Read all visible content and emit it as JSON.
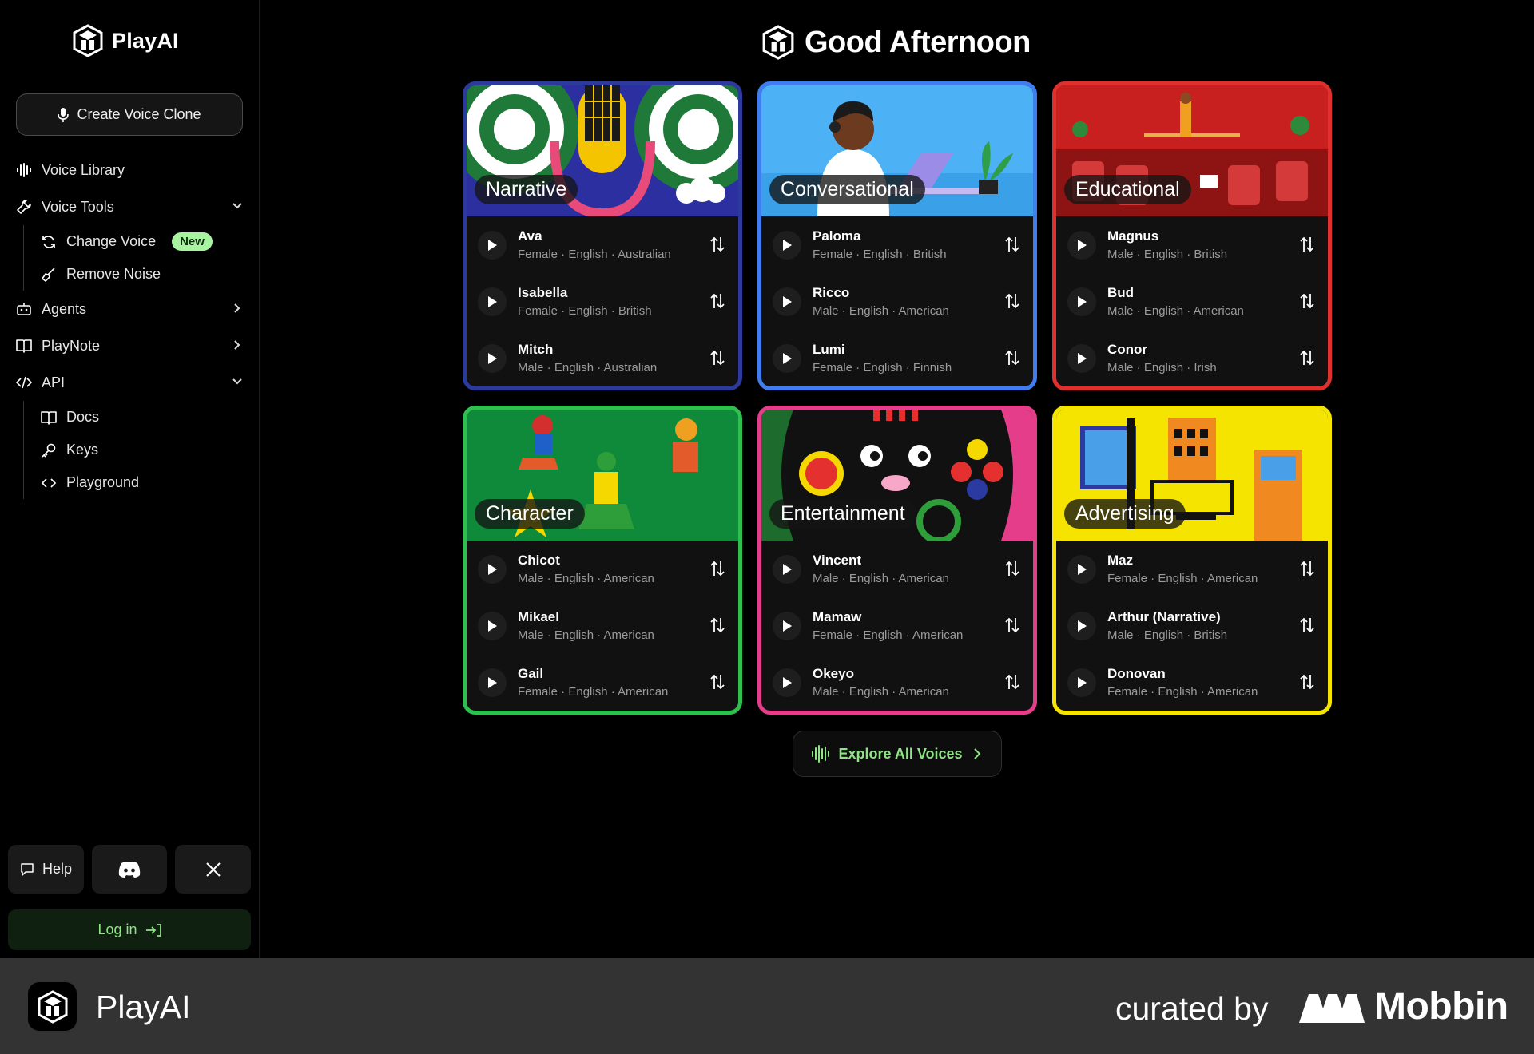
{
  "app": {
    "name": "PlayAI"
  },
  "sidebar": {
    "create_clone": "Create Voice Clone",
    "voice_library": "Voice Library",
    "voice_tools": "Voice Tools",
    "change_voice": "Change Voice",
    "new_badge": "New",
    "remove_noise": "Remove Noise",
    "agents": "Agents",
    "playnote": "PlayNote",
    "api": "API",
    "docs": "Docs",
    "keys": "Keys",
    "playground": "Playground",
    "help": "Help",
    "login": "Log in"
  },
  "main": {
    "greeting": "Good Afternoon",
    "explore": "Explore All Voices",
    "cards": [
      {
        "label": "Narrative",
        "border": "#2b3a9c",
        "voices": [
          {
            "name": "Ava",
            "meta": "Female · English · Australian"
          },
          {
            "name": "Isabella",
            "meta": "Female · English · British"
          },
          {
            "name": "Mitch",
            "meta": "Male · English · Australian"
          }
        ]
      },
      {
        "label": "Conversational",
        "border": "#3f7df0",
        "voices": [
          {
            "name": "Paloma",
            "meta": "Female · English · British"
          },
          {
            "name": "Ricco",
            "meta": "Male · English · American"
          },
          {
            "name": "Lumi",
            "meta": "Female · English · Finnish"
          }
        ]
      },
      {
        "label": "Educational",
        "border": "#e0302e",
        "voices": [
          {
            "name": "Magnus",
            "meta": "Male · English · British"
          },
          {
            "name": "Bud",
            "meta": "Male · English · American"
          },
          {
            "name": "Conor",
            "meta": "Male · English · Irish"
          }
        ]
      },
      {
        "label": "Character",
        "border": "#2fbf4f",
        "voices": [
          {
            "name": "Chicot",
            "meta": "Male · English · American"
          },
          {
            "name": "Mikael",
            "meta": "Male · English · American"
          },
          {
            "name": "Gail",
            "meta": "Female · English · American"
          }
        ]
      },
      {
        "label": "Entertainment",
        "border": "#e53d8a",
        "voices": [
          {
            "name": "Vincent",
            "meta": "Male · English · American"
          },
          {
            "name": "Mamaw",
            "meta": "Female · English · American"
          },
          {
            "name": "Okeyo",
            "meta": "Male · English · American"
          }
        ]
      },
      {
        "label": "Advertising",
        "border": "#f5e400",
        "voices": [
          {
            "name": "Maz",
            "meta": "Female · English · American"
          },
          {
            "name": "Arthur (Narrative)",
            "meta": "Male · English · British"
          },
          {
            "name": "Donovan",
            "meta": "Female · English · American"
          }
        ]
      }
    ]
  },
  "footer": {
    "app": "PlayAI",
    "curated": "curated by",
    "brand": "Mobbin"
  },
  "colors": {
    "accent_green": "#8ee584",
    "background": "#000000"
  }
}
